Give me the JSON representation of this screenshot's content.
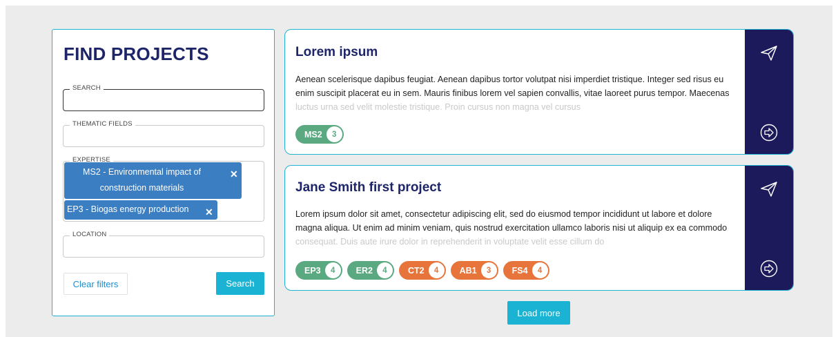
{
  "filters": {
    "title": "FIND PROJECTS",
    "search": {
      "legend": "SEARCH",
      "value": "",
      "placeholder": ""
    },
    "thematic_fields": {
      "legend": "THEMATIC FIELDS",
      "value": ""
    },
    "expertise": {
      "legend": "EXPERTISE",
      "chips": [
        {
          "line1": "MS2 - Environmental impact of",
          "line2": "construction materials"
        },
        {
          "label": "EP3 - Biogas energy production"
        }
      ]
    },
    "location": {
      "legend": "LOCATION",
      "value": ""
    },
    "clear_label": "Clear filters",
    "search_label": "Search"
  },
  "projects": [
    {
      "title": "Lorem ipsum",
      "description": "Aenean scelerisque dapibus feugiat. Aenean dapibus tortor volutpat nisi imperdiet tristique. Integer sed risus eu enim suscipit placerat eu in sem. Mauris finibus lorem vel sapien convallis, vitae laoreet purus tempor. Maecenas luctus urna sed velit molestie tristique. Proin cursus non magna vel cursus",
      "tags": [
        {
          "code": "MS2",
          "count": "3",
          "color": "green"
        }
      ]
    },
    {
      "title": "Jane Smith first project",
      "description": "Lorem ipsum dolor sit amet, consectetur adipiscing elit, sed do eiusmod tempor incididunt ut labore et dolore magna aliqua. Ut enim ad minim veniam, quis nostrud exercitation ullamco laboris nisi ut aliquip ex ea commodo consequat. Duis aute irure dolor in reprehenderit in voluptate velit esse cillum do",
      "tags": [
        {
          "code": "EP3",
          "count": "4",
          "color": "green"
        },
        {
          "code": "ER2",
          "count": "4",
          "color": "green"
        },
        {
          "code": "CT2",
          "count": "4",
          "color": "orange"
        },
        {
          "code": "AB1",
          "count": "3",
          "color": "orange"
        },
        {
          "code": "FS4",
          "count": "4",
          "color": "orange"
        }
      ]
    }
  ],
  "load_more_label": "Load more",
  "colors": {
    "accent": "#1bb3d4",
    "navy": "#1d2568",
    "sidebar": "#1d1a5c",
    "chip": "#3b7ec2",
    "tag_green": "#5aa981",
    "tag_orange": "#e7743b"
  },
  "icons": {
    "send": "paper-plane-icon",
    "open": "arrow-right-circle-icon",
    "remove": "close-icon"
  }
}
